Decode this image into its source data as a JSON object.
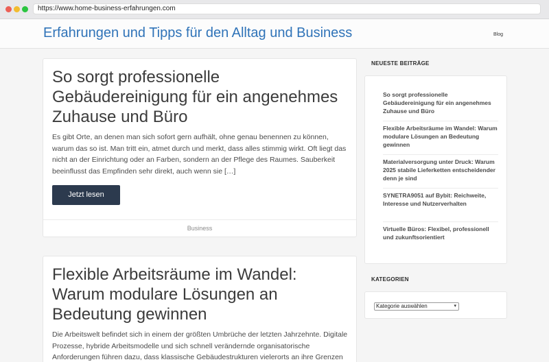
{
  "browser": {
    "url": "https://www.home-business-erfahrungen.com"
  },
  "header": {
    "site_title": "Erfahrungen und Tipps für den Alltag und Business",
    "nav": [
      "Blog"
    ]
  },
  "posts": [
    {
      "title": "So sorgt professionelle Gebäudereinigung für ein angenehmes Zuhause und Büro",
      "excerpt": "Es gibt Orte, an denen man sich sofort gern aufhält, ohne genau benennen zu können, warum das so ist. Man tritt ein, atmet durch und merkt, dass alles stimmig wirkt. Oft liegt das nicht an der Einrichtung oder an Farben, sondern an der Pflege des Raumes. Sauberkeit beeinflusst das Empfinden sehr direkt, auch wenn sie […]",
      "button": "Jetzt lesen",
      "category": "Business"
    },
    {
      "title": "Flexible Arbeitsräume im Wandel: Warum modulare Lösungen an Bedeutung gewinnen",
      "excerpt": "Die Arbeitswelt befindet sich in einem der größten Umbrüche der letzten Jahrzehnte. Digitale Prozesse, hybride Arbeitsmodelle und sich schnell verändernde organisatorische Anforderungen führen dazu, dass klassische Gebäudestrukturen vielerorts an ihre Grenzen"
    }
  ],
  "sidebar": {
    "recent_title": "NEUESTE BEITRÄGE",
    "recent": [
      "So sorgt professionelle Gebäudereinigung für ein angenehmes Zuhause und Büro",
      "Flexible Arbeitsräume im Wandel: Warum modulare Lösungen an Bedeutung gewinnen",
      "Materialversorgung unter Druck: Warum 2025 stabile Lieferketten entscheidender denn je sind",
      "SYNETRA9051 auf Bybit: Reichweite, Interesse und Nutzerverhalten",
      "Virtuelle Büros: Flexibel, professionell und zukunftsorientiert"
    ],
    "categories_title": "KATEGORIEN",
    "category_select": "Kategorie auswählen"
  },
  "colors": {
    "link_blue": "#2f73b8",
    "button_dark": "#2c3a4e"
  }
}
